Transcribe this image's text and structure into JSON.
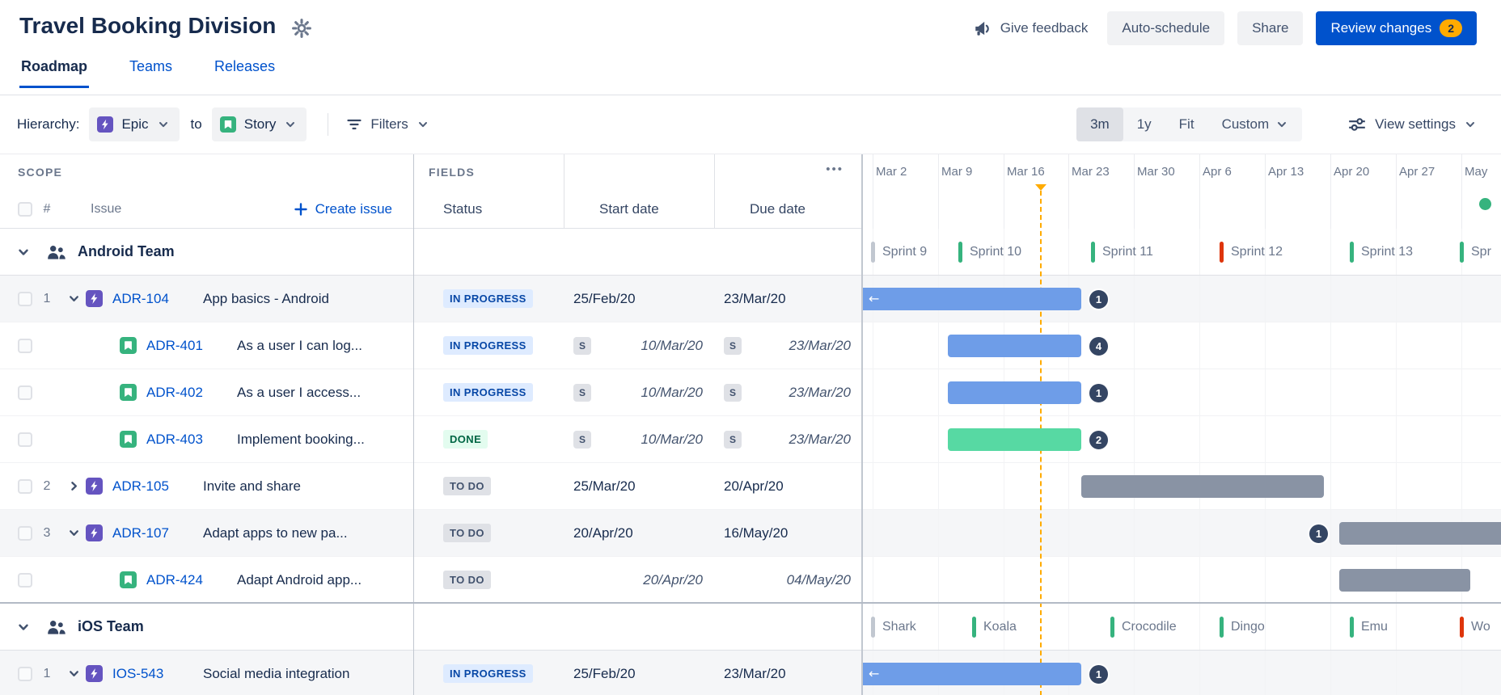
{
  "colors": {
    "accent_blue": "#0052CC",
    "bar_blue": "#6E9DE8",
    "bar_green": "#57D9A3",
    "bar_gray": "#8993A4",
    "today_line_orange": "#FFAB00",
    "epic_purple": "#6554C0",
    "story_green": "#36B37E",
    "count_badge_navy": "#344563",
    "sprint_green": "#36B37E",
    "sprint_red": "#DE350B",
    "sprint_gray": "#C1C7D0",
    "release_dot_green": "#36B37E",
    "status_in_progress": {
      "bg": "#DEEBFF",
      "text": "#0747A6"
    },
    "status_done": {
      "bg": "#E3FCEF",
      "text": "#006644"
    },
    "status_todo": {
      "bg": "#DFE1E6",
      "text": "#42526E"
    }
  },
  "header": {
    "title": "Travel Booking Division",
    "actions": {
      "give_feedback": "Give feedback",
      "auto_schedule": "Auto-schedule",
      "share": "Share",
      "review_changes": "Review changes",
      "review_count": "2"
    }
  },
  "tabs": [
    {
      "label": "Roadmap",
      "active": true
    },
    {
      "label": "Teams",
      "active": false
    },
    {
      "label": "Releases",
      "active": false
    }
  ],
  "toolbar": {
    "hierarchy_label": "Hierarchy:",
    "from_level": "Epic",
    "to_word": "to",
    "to_level": "Story",
    "filters_label": "Filters",
    "zoom_options": [
      "3m",
      "1y",
      "Fit",
      "Custom"
    ],
    "active_zoom": "3m",
    "view_settings_label": "View settings"
  },
  "scope_panel": {
    "title": "SCOPE",
    "number_col": "#",
    "issue_col": "Issue",
    "create_issue": "Create issue"
  },
  "fields_panel": {
    "title": "FIELDS",
    "more_button": "•••",
    "sprint_s": "S",
    "columns": [
      "Status",
      "Start date",
      "Due date"
    ]
  },
  "timeline": {
    "weeks": [
      "Mar 2",
      "Mar 9",
      "Mar 16",
      "Mar 23",
      "Mar 30",
      "Apr 6",
      "Apr 13",
      "Apr 20",
      "Apr 27",
      "May"
    ],
    "overflow_arrow": "←",
    "android_sprints": [
      {
        "name": "Sprint 9",
        "color": "#C1C7D0"
      },
      {
        "name": "Sprint 10",
        "color": "#36B37E"
      },
      {
        "name": "Sprint 11",
        "color": "#36B37E"
      },
      {
        "name": "Sprint 12",
        "color": "#DE350B"
      },
      {
        "name": "Sprint 13",
        "color": "#36B37E"
      },
      {
        "name": "Spr",
        "color": "#36B37E"
      }
    ],
    "ios_sprints": [
      {
        "name": "Shark",
        "color": "#C1C7D0"
      },
      {
        "name": "Koala",
        "color": "#36B37E"
      },
      {
        "name": "Crocodile",
        "color": "#36B37E"
      },
      {
        "name": "Dingo",
        "color": "#36B37E"
      },
      {
        "name": "Emu",
        "color": "#36B37E"
      },
      {
        "name": "Wo",
        "color": "#DE350B"
      }
    ]
  },
  "groups": [
    {
      "name": "Android Team",
      "rows": [
        {
          "num": "1",
          "type": "epic",
          "expanded": true,
          "key": "ADR-104",
          "summary": "App basics - Android",
          "status": "IN PROGRESS",
          "start": "25/Feb/20",
          "due": "23/Mar/20",
          "badge": "1"
        },
        {
          "num": "",
          "type": "story",
          "key": "ADR-401",
          "summary": "As a user I can log...",
          "status": "IN PROGRESS",
          "start": "10/Mar/20",
          "due": "23/Mar/20",
          "badge": "4"
        },
        {
          "num": "",
          "type": "story",
          "key": "ADR-402",
          "summary": "As a user I access...",
          "status": "IN PROGRESS",
          "start": "10/Mar/20",
          "due": "23/Mar/20",
          "badge": "1"
        },
        {
          "num": "",
          "type": "story",
          "key": "ADR-403",
          "summary": "Implement booking...",
          "status": "DONE",
          "start": "10/Mar/20",
          "due": "23/Mar/20",
          "badge": "2"
        },
        {
          "num": "2",
          "type": "epic",
          "expanded": false,
          "key": "ADR-105",
          "summary": "Invite and share",
          "status": "TO DO",
          "start": "25/Mar/20",
          "due": "20/Apr/20"
        },
        {
          "num": "3",
          "type": "epic",
          "expanded": true,
          "key": "ADR-107",
          "summary": "Adapt apps to new pa...",
          "status": "TO DO",
          "start": "20/Apr/20",
          "due": "16/May/20",
          "badge": "1"
        },
        {
          "num": "",
          "type": "story",
          "key": "ADR-424",
          "summary": "Adapt Android app...",
          "status": "TO DO",
          "start": "20/Apr/20",
          "due": "04/May/20"
        }
      ]
    },
    {
      "name": "iOS Team",
      "rows": [
        {
          "num": "1",
          "type": "epic",
          "expanded": true,
          "key": "IOS-543",
          "summary": "Social media integration",
          "status": "IN PROGRESS",
          "start": "25/Feb/20",
          "due": "23/Mar/20",
          "badge": "1"
        }
      ]
    }
  ]
}
